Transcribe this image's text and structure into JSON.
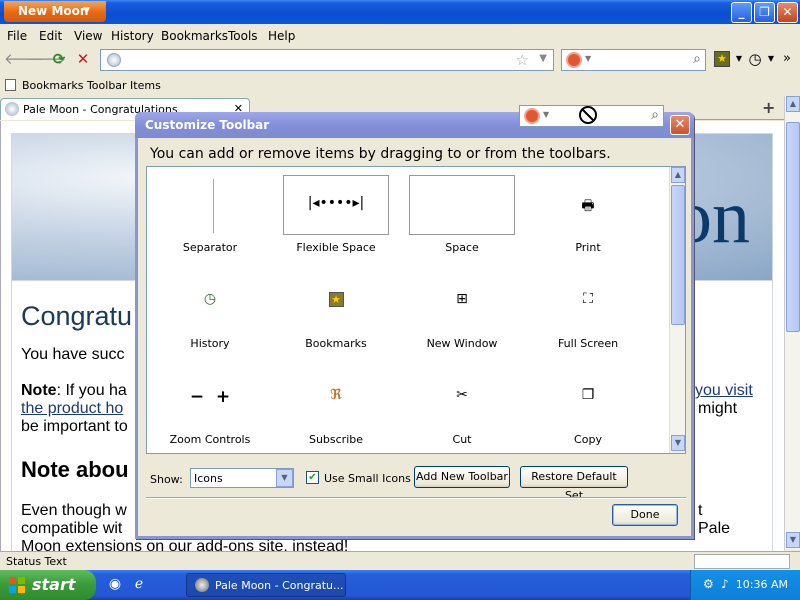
{
  "window": {
    "app_button": "New Moon",
    "min": "_",
    "max": "❐",
    "close": "✕"
  },
  "menubar": {
    "items": [
      "File",
      "Edit",
      "View",
      "History",
      "Bookmarks",
      "Tools",
      "Help"
    ]
  },
  "bookmarks_toolbar": {
    "label": "Bookmarks Toolbar Items"
  },
  "tabs": [
    {
      "label": "Pale Moon - Congratulations"
    }
  ],
  "tab_controls": {
    "new_tab": "+",
    "close_tab": "✕"
  },
  "page": {
    "hero_text": "on",
    "heading": "Congratu",
    "line1": "You have succ",
    "note_bold": "Note",
    "note_text": ": If you ha",
    "note_link_right": "you visit",
    "line_link": "the product ho",
    "line_right": "might",
    "line3": "be important to",
    "heading2": "Note abou",
    "para2_line1": "Even though w",
    "para2_line1_right": "t",
    "para2_line2": "compatible wit",
    "para2_line2_right": "Pale",
    "para2_line3": "Moon extensions on our add-ons site, instead!"
  },
  "statusbar": {
    "text": "Status Text"
  },
  "taskbar": {
    "start": "start",
    "task_button": "Pale Moon - Congratu...",
    "clock": "10:36 AM"
  },
  "dialog": {
    "title": "Customize Toolbar",
    "close": "✕",
    "hint": "You can add or remove items by dragging to or from the toolbars.",
    "items": [
      {
        "label": "Separator",
        "icon": "separator-icon"
      },
      {
        "label": "Flexible Space",
        "icon": "flexible-space-icon"
      },
      {
        "label": "Space",
        "icon": "space-icon"
      },
      {
        "label": "Print",
        "icon": "print-icon"
      },
      {
        "label": "History",
        "icon": "history-icon"
      },
      {
        "label": "Bookmarks",
        "icon": "bookmarks-icon"
      },
      {
        "label": "New Window",
        "icon": "new-window-icon"
      },
      {
        "label": "Full Screen",
        "icon": "full-screen-icon"
      },
      {
        "label": "Zoom Controls",
        "icon": "zoom-controls-icon"
      },
      {
        "label": "Subscribe",
        "icon": "subscribe-icon"
      },
      {
        "label": "Cut",
        "icon": "cut-icon"
      },
      {
        "label": "Copy",
        "icon": "copy-icon"
      }
    ],
    "show_label": "Show:",
    "show_value": "Icons",
    "small_icons_label": "Use Small Icons",
    "small_icons_checked": true,
    "add_toolbar": "Add New Toolbar",
    "restore_default": "Restore Default Set",
    "done": "Done"
  },
  "colors": {
    "titlebar": "#0a4ed0",
    "dialog_title": "#8290d8",
    "accent_orange": "#e66a12"
  }
}
